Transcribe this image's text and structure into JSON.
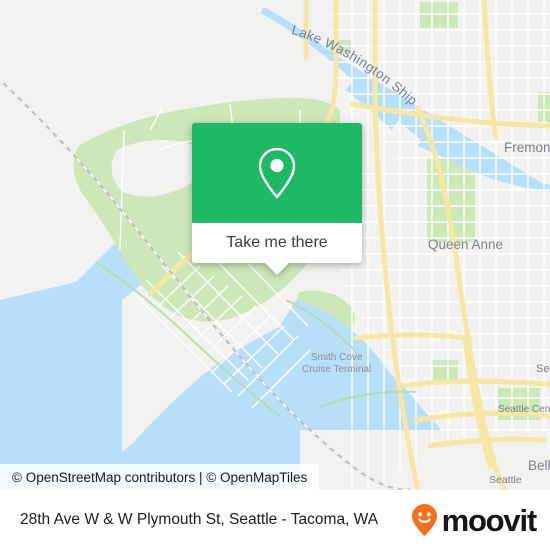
{
  "app": {
    "brand_name": "moovit",
    "brand_color": "#F37021"
  },
  "map": {
    "attribution": "© OpenStreetMap contributors | © OpenMapTiles",
    "water_color": "#B8DFFA",
    "land_color": "#F2F2F0",
    "park_color": "#CCE8B8",
    "road_color": "#FFFFFF",
    "arterial_color": "#F8E9A8",
    "labels": [
      {
        "name": "lake-washington-ship-canal",
        "text": "Lake Washington Ship Canal",
        "type": "water"
      },
      {
        "name": "fremont",
        "text": "Fremont",
        "type": "place"
      },
      {
        "name": "queen-anne",
        "text": "Queen Anne",
        "type": "place"
      },
      {
        "name": "seattle-center",
        "text": "Seattle Cente",
        "type": "place"
      },
      {
        "name": "belltown",
        "text": "Bell",
        "type": "place"
      },
      {
        "name": "seattle",
        "text": "Seattle",
        "type": "place"
      },
      {
        "name": "smith-cove-line-1",
        "text": "Smith Cove",
        "type": "poi"
      },
      {
        "name": "smith-cove-line-2",
        "text": "Cruise Terminal",
        "type": "poi"
      },
      {
        "name": "se-partial",
        "text": "Se",
        "type": "place"
      }
    ]
  },
  "callout": {
    "header_color": "#1FB966",
    "pin_icon": "location-pin-icon",
    "action_label": "Take me there"
  },
  "footer": {
    "address": "28th Ave W & W Plymouth St, Seattle - Tacoma, WA"
  }
}
